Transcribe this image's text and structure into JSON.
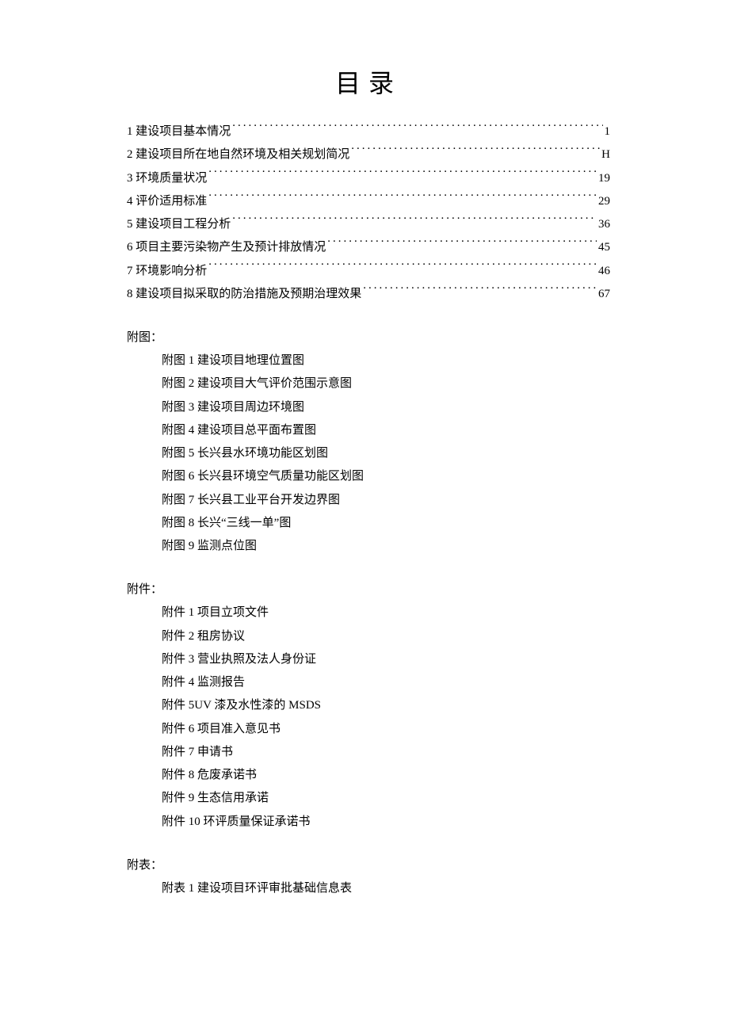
{
  "title": "目录",
  "toc": [
    {
      "label": "1 建设项目基本情况",
      "page": "1"
    },
    {
      "label": "2 建设项目所在地自然环境及相关规划简况",
      "page": "H"
    },
    {
      "label": "3 环境质量状况",
      "page": "19"
    },
    {
      "label": "4 评价适用标准",
      "page": "29"
    },
    {
      "label": "5 建设项目工程分析",
      "page": "36"
    },
    {
      "label": "6 项目主要污染物产生及预计排放情况",
      "page": "45"
    },
    {
      "label": "7 环境影响分析",
      "page": "46"
    },
    {
      "label": "8 建设项目拟采取的防治措施及预期治理效果",
      "page": "67"
    }
  ],
  "sections": {
    "futu": {
      "heading": "附图：",
      "items": [
        "附图 1 建设项目地理位置图",
        "附图 2 建设项目大气评价范围示意图",
        "附图 3 建设项目周边环境图",
        "附图 4 建设项目总平面布置图",
        "附图 5 长兴县水环境功能区划图",
        "附图 6 长兴县环境空气质量功能区划图",
        "附图 7 长兴县工业平台开发边界图",
        "附图 8 长兴“三线一单”图",
        "附图 9 监测点位图"
      ]
    },
    "fujian": {
      "heading": "附件：",
      "items": [
        "附件 1 项目立项文件",
        "附件 2 租房协议",
        "附件 3 营业执照及法人身份证",
        "附件 4 监测报告",
        "附件 5UV 漆及水性漆的 MSDS",
        "附件 6 项目准入意见书",
        "附件 7 申请书",
        "附件 8 危废承诺书",
        "附件 9 生态信用承诺",
        "附件 10 环评质量保证承诺书"
      ]
    },
    "fubiao": {
      "heading": "附表：",
      "items": [
        "附表 1 建设项目环评审批基础信息表"
      ]
    }
  }
}
